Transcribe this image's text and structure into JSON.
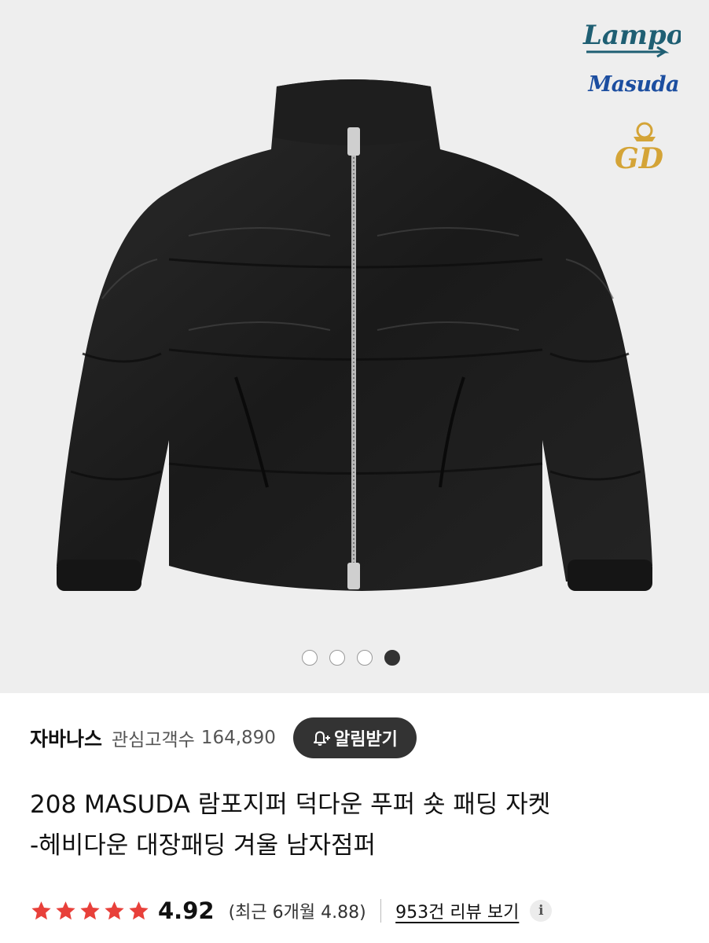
{
  "gallery": {
    "image_subject": "jacket-photo",
    "brand_logos": [
      "Lampo",
      "Masuda",
      "GD"
    ],
    "page_count": 4,
    "active_page": 4
  },
  "seller": {
    "name": "자바나스",
    "follower_label": "관심고객수",
    "follower_count": "164,890",
    "alert_button_label": "알림받기"
  },
  "product": {
    "title_line1": "208 MASUDA 람포지퍼 덕다운 푸퍼 숏 패딩 자켓",
    "title_line2": "-헤비다운 대장패딩 겨울 남자점퍼"
  },
  "rating": {
    "stars": 5,
    "value": "4.92",
    "recent_text": "(최근 6개월 4.88)",
    "reviews_link": "953건 리뷰 보기",
    "info_icon": "i"
  },
  "colors": {
    "star": "#e8403a",
    "button_bg": "#333333",
    "hero_bg": "#eeeeee",
    "masuda_blue": "#1c4ea0",
    "lampo_teal": "#1f5f73",
    "gd_gold": "#d4a437"
  }
}
